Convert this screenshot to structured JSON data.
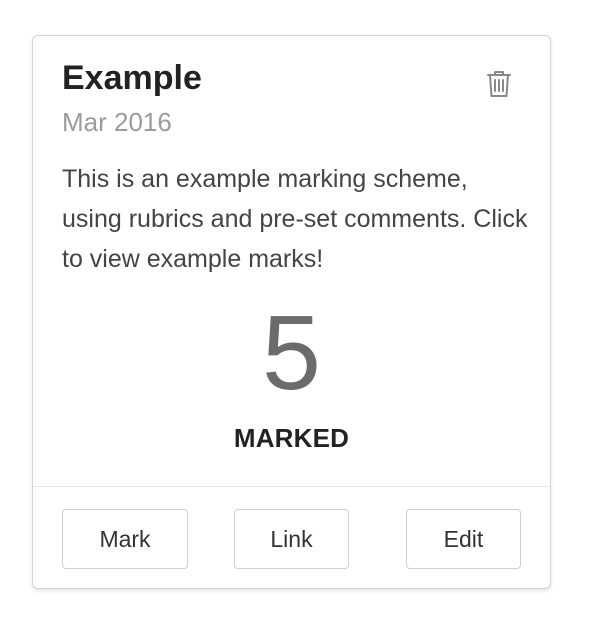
{
  "card": {
    "title": "Example",
    "date": "Mar 2016",
    "description": "This is an example marking scheme, using rubrics and pre-set comments. Click to view example marks!",
    "marked_count": "5",
    "marked_label": "MARKED",
    "delete_icon": "trash-icon"
  },
  "actions": {
    "mark_label": "Mark",
    "link_label": "Link",
    "edit_label": "Edit"
  },
  "colors": {
    "title": "#222222",
    "date": "#9b9b9b",
    "count": "#6b6b6b",
    "border": "#d3d3d3"
  }
}
